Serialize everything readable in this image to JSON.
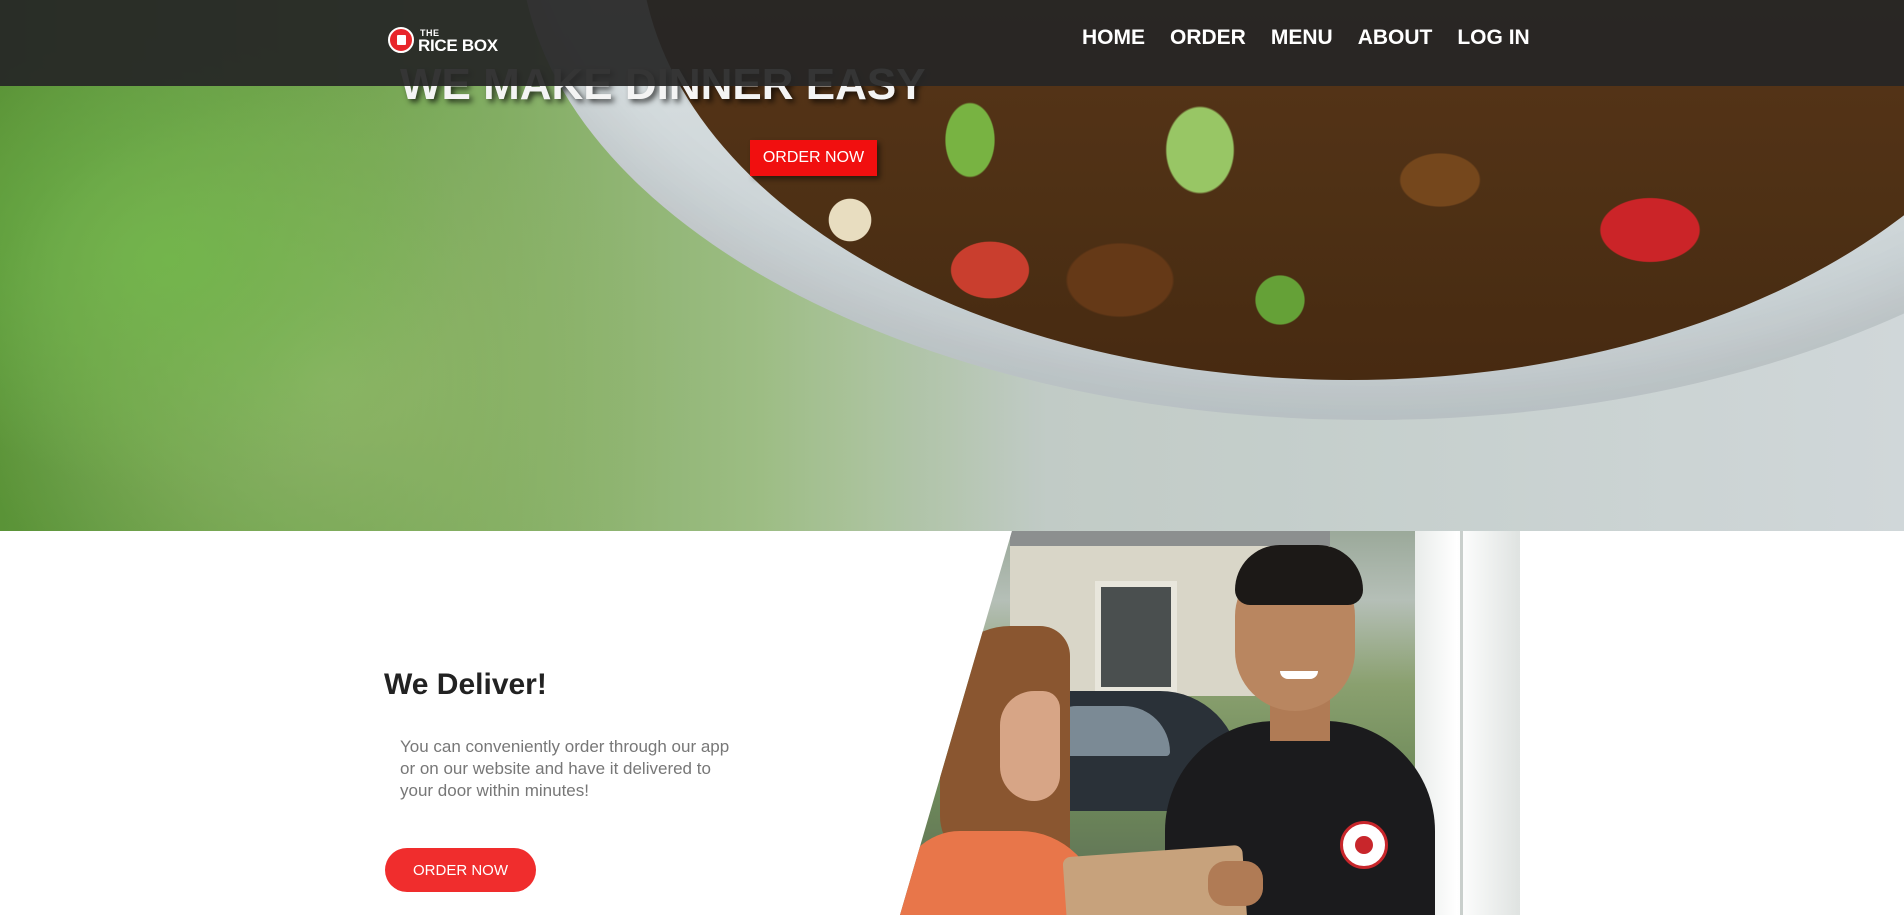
{
  "brand": {
    "the": "THE",
    "name": "RICE BOX"
  },
  "nav": {
    "items": [
      "HOME",
      "ORDER",
      "MENU",
      "ABOUT",
      "LOG IN"
    ]
  },
  "hero": {
    "title": "WE MAKE DINNER EASY",
    "button": "ORDER NOW"
  },
  "delivery": {
    "title": "We Deliver!",
    "text": "You can conveniently order through our app or on our website and have it delivered to your door within minutes!",
    "button": "ORDER NOW"
  },
  "colors": {
    "accent": "#f10f0f",
    "nav_bg": "#262626",
    "pill_button": "#f02d2d"
  }
}
